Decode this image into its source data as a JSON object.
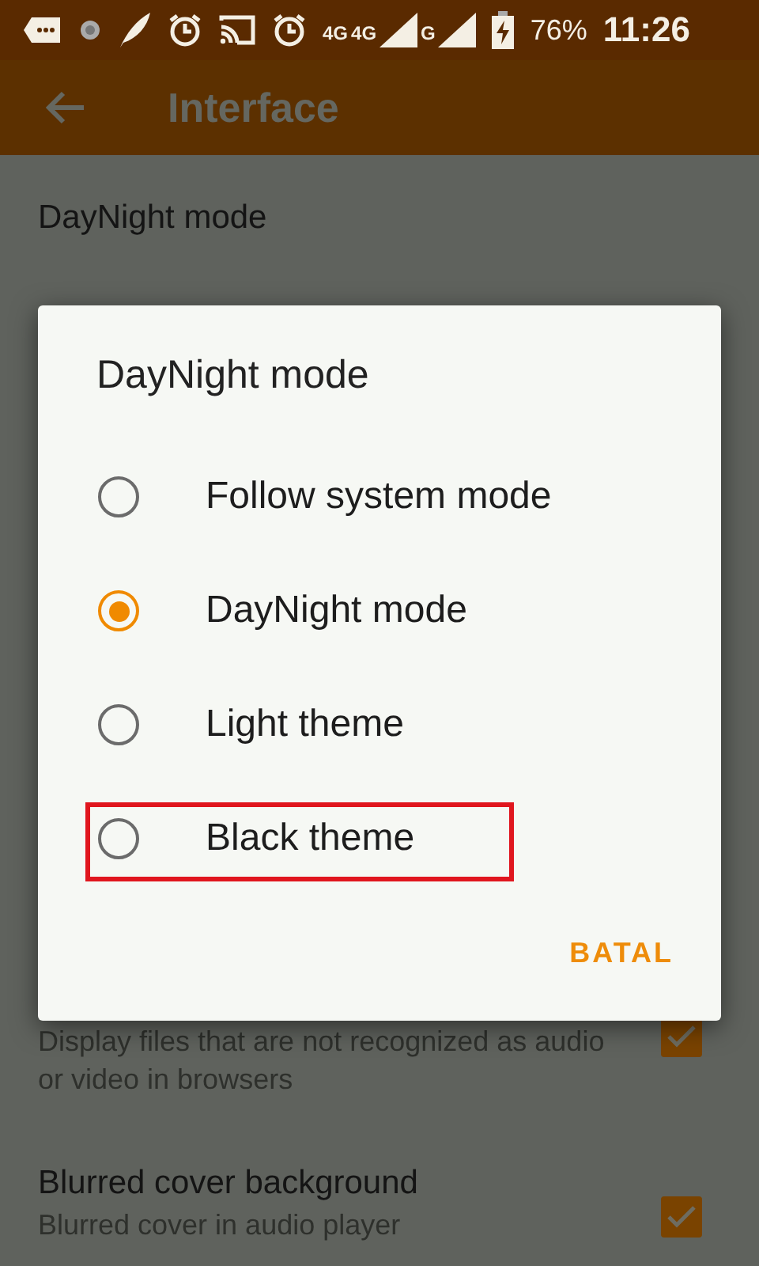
{
  "status_bar": {
    "network_labels": [
      "4G",
      "4G",
      "G"
    ],
    "battery": "76%",
    "time": "11:26"
  },
  "app_bar": {
    "title": "Interface"
  },
  "settings": [
    {
      "title": "DayNight mode"
    },
    {
      "description": "Display files that are not recognized as audio or video in browsers",
      "checked": true
    },
    {
      "title": "Blurred cover background",
      "description": "Blurred cover in audio player",
      "checked": true
    }
  ],
  "dialog": {
    "title": "DayNight mode",
    "options": [
      {
        "label": "Follow system mode",
        "selected": false,
        "highlighted": false
      },
      {
        "label": "DayNight mode",
        "selected": true,
        "highlighted": false
      },
      {
        "label": "Light theme",
        "selected": false,
        "highlighted": false
      },
      {
        "label": "Black theme",
        "selected": false,
        "highlighted": true
      }
    ],
    "buttons": [
      "BATAL"
    ]
  }
}
